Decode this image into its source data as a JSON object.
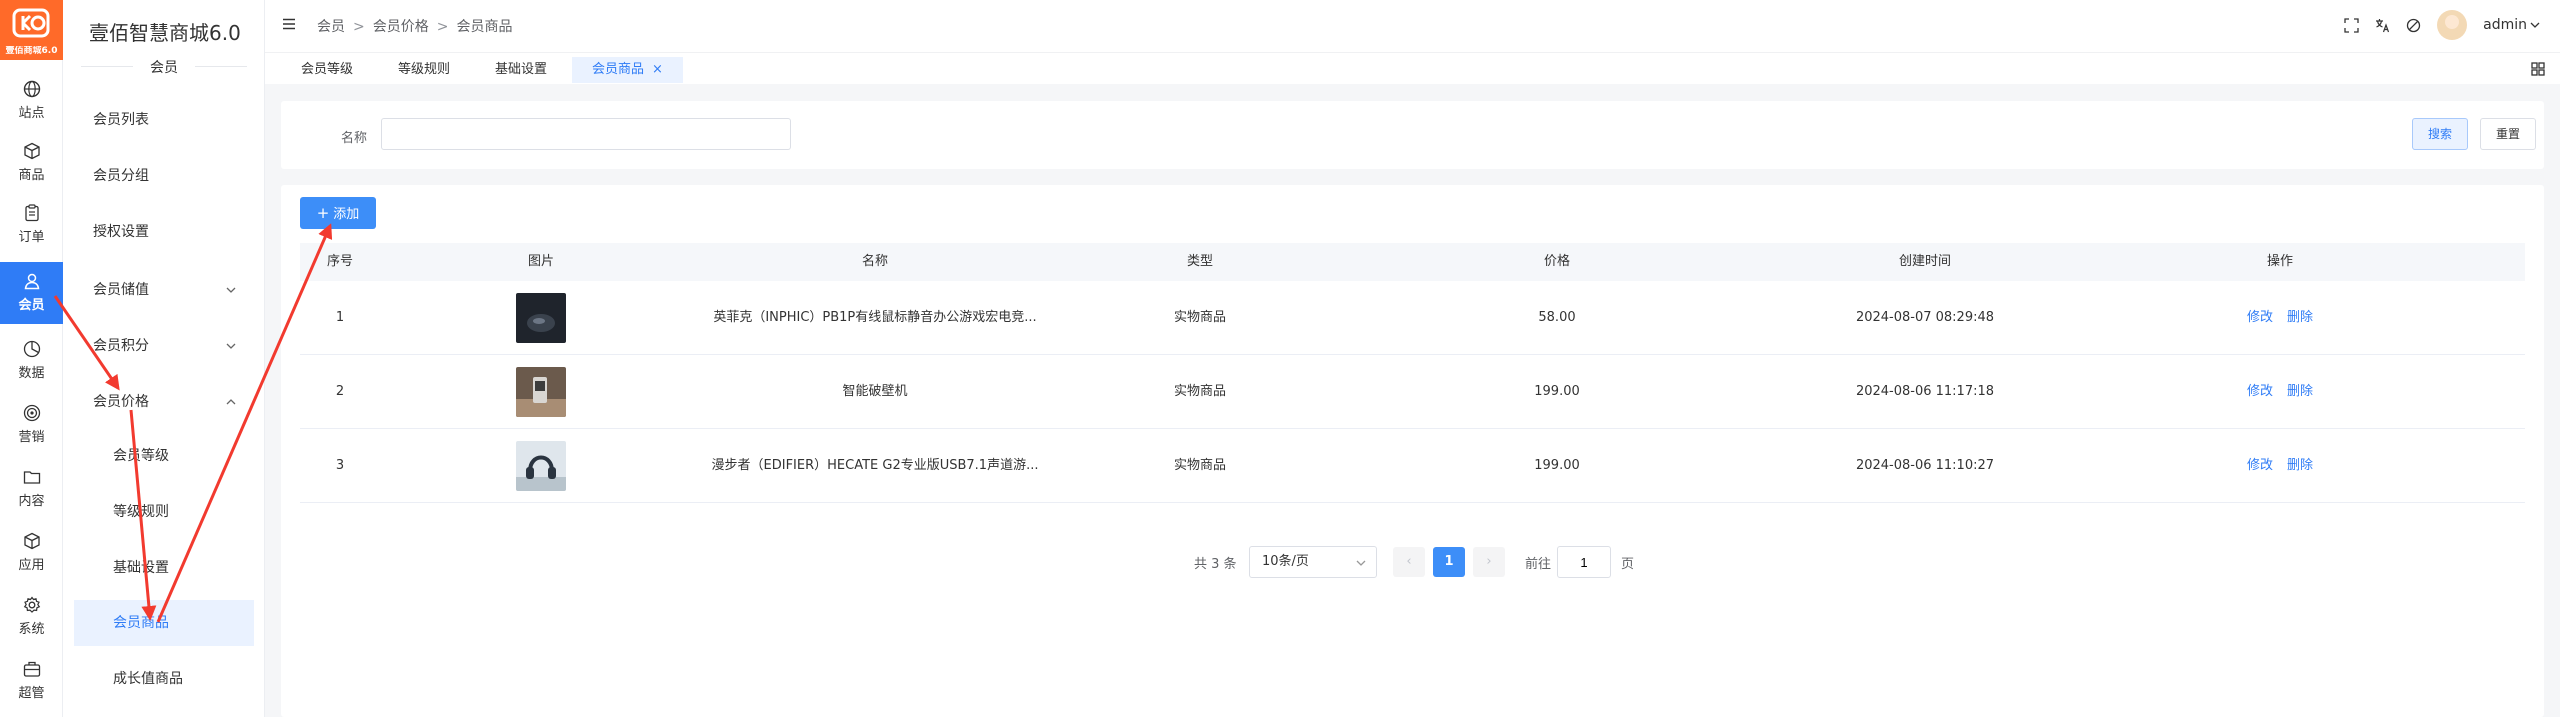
{
  "logo": {
    "subtitle": "壹佰商城6.0"
  },
  "brand": {
    "title": "壹佰智慧商城6.0"
  },
  "rail": [
    {
      "label": "站点",
      "icon": "globe-icon"
    },
    {
      "label": "商品",
      "icon": "box-icon"
    },
    {
      "label": "订单",
      "icon": "clipboard-icon"
    },
    {
      "label": "会员",
      "icon": "user-icon",
      "active": true
    },
    {
      "label": "数据",
      "icon": "pie-chart-icon"
    },
    {
      "label": "营销",
      "icon": "target-icon"
    },
    {
      "label": "内容",
      "icon": "folder-icon"
    },
    {
      "label": "应用",
      "icon": "cube-icon"
    },
    {
      "label": "系统",
      "icon": "gear-icon"
    },
    {
      "label": "超管",
      "icon": "briefcase-icon"
    }
  ],
  "submenu": {
    "section": "会员",
    "items": [
      {
        "label": "会员列表"
      },
      {
        "label": "会员分组"
      },
      {
        "label": "授权设置"
      },
      {
        "label": "会员储值"
      },
      {
        "label": "会员积分"
      },
      {
        "label": "会员价格"
      },
      {
        "label": "会员等级"
      },
      {
        "label": "等级规则"
      },
      {
        "label": "基础设置"
      },
      {
        "label": "会员商品"
      },
      {
        "label": "成长值商品"
      }
    ]
  },
  "breadcrumb": [
    "会员",
    "会员价格",
    "会员商品"
  ],
  "breadcrumb_sep": ">",
  "user": {
    "name": "admin"
  },
  "tabs": [
    {
      "label": "会员等级"
    },
    {
      "label": "等级规则"
    },
    {
      "label": "基础设置"
    },
    {
      "label": "会员商品",
      "active": true,
      "close": "×"
    }
  ],
  "search": {
    "label": "名称",
    "value": "",
    "search_label": "搜索",
    "reset_label": "重置"
  },
  "add_label": "添加",
  "add_plus": "+",
  "table": {
    "headers": [
      "序号",
      "图片",
      "名称",
      "类型",
      "价格",
      "创建时间",
      "操作"
    ],
    "rows": [
      {
        "index": "1",
        "name": "英菲克（INPHIC）PB1P有线鼠标静音办公游戏宏电竞...",
        "type": "实物商品",
        "price": "58.00",
        "created": "2024-08-07 08:29:48",
        "edit": "修改",
        "del": "删除"
      },
      {
        "index": "2",
        "name": "智能破壁机",
        "type": "实物商品",
        "price": "199.00",
        "created": "2024-08-06 11:17:18",
        "edit": "修改",
        "del": "删除"
      },
      {
        "index": "3",
        "name": "漫步者（EDIFIER）HECATE G2专业版USB7.1声道游...",
        "type": "实物商品",
        "price": "199.00",
        "created": "2024-08-06 11:10:27",
        "edit": "修改",
        "del": "删除"
      }
    ]
  },
  "pagination": {
    "total": "共 3 条",
    "page_size": "10条/页",
    "prev": "‹",
    "current": "1",
    "next": "›",
    "goto": "前往",
    "goto_value": "1",
    "page_unit": "页"
  },
  "colors": {
    "primary": "#2f7cf6",
    "logo": "#ff6a29",
    "annotation": "#f23a2f"
  }
}
